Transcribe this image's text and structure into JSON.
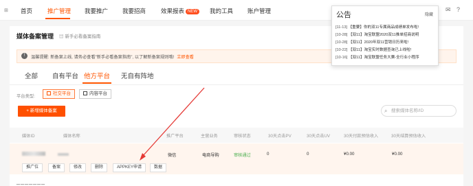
{
  "nav": {
    "logo": "⊞",
    "items": [
      "首页",
      "推广管理",
      "我要推广",
      "我要招商",
      "效果报表",
      "我的工具",
      "账户管理"
    ],
    "new_badge": "NEW",
    "icons": [
      "mail-icon",
      "help-icon"
    ]
  },
  "notice": {
    "title": "公告",
    "hide": "隐藏",
    "items": [
      {
        "date": "[11-13]",
        "text": "【重要】你的双11专属商品成绩单发布啦!"
      },
      {
        "date": "[10-28]",
        "text": "【双11】淘宝联盟2020双11推单招商说明"
      },
      {
        "date": "[10-28]",
        "text": "【双11】2020年双11营销日历来啦!"
      },
      {
        "date": "[10-22]",
        "text": "【双11】淘宝实时数据查询已上线啦!"
      },
      {
        "date": "[10-16]",
        "text": "【双11】淘宝联盟任务大赛-全行业小程序"
      }
    ]
  },
  "page": {
    "title": "媒体备案管理",
    "guide_link": "新手必看备案指南",
    "tip": "温馨提醒: 新备案上线, 请务必查看\"新手必看备案指南\", 以了解新备案规则哦!",
    "tip_link": "立即查看"
  },
  "tabs": [
    "全部",
    "自有平台",
    "他方平台",
    "无自有阵地"
  ],
  "platform_type": {
    "label": "平台类型:",
    "options": [
      "社交平台",
      "内容平台"
    ]
  },
  "add_button": "+ 新增媒体备案",
  "search": {
    "placeholder": "搜索媒体名称/ID"
  },
  "table": {
    "headers": [
      "媒体ID",
      "媒体名称",
      "推广平台",
      "主营业务",
      "审核状态",
      "30天点击PV",
      "30天点击UV",
      "30天付款预估收入",
      "30天结算预估收入"
    ],
    "row": {
      "platform": "微信",
      "business": "电商导购",
      "status": "审核通过",
      "pv": "0",
      "uv": "0",
      "pay_income": "¥0.00",
      "settle_income": "¥0.00"
    },
    "actions": [
      "推广位",
      "备案",
      "修改",
      "删除",
      "APPKEY申请",
      "数据"
    ]
  },
  "bottom_text": "_______",
  "colors": {
    "accent": "#ff5500",
    "arrow": "#e53935"
  }
}
